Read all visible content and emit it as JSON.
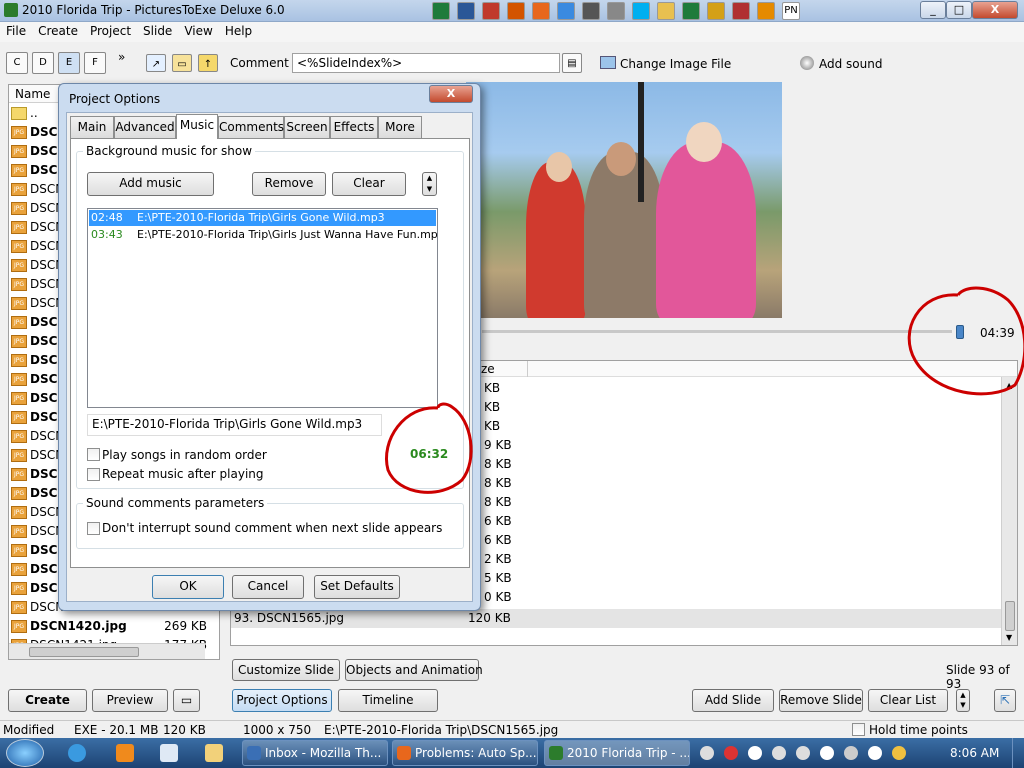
{
  "window": {
    "title": "2010 Florida Trip - PicturesToExe Deluxe 6.0",
    "min": "_",
    "max": "□",
    "close": "X",
    "titlebar_icons": [
      "ms-excel-icon",
      "ms-word-icon",
      "pdf-icon",
      "powerpoint-icon",
      "firefox-icon",
      "chrome-icon",
      "media-icon",
      "mail-icon",
      "skype-icon",
      "folder-icon",
      "excel-icon",
      "pen-icon",
      "home-icon",
      "headset-icon",
      "pn-icon"
    ],
    "pn_label": "PN"
  },
  "menu": [
    "File",
    "Create",
    "Project",
    "Slide",
    "View",
    "Help"
  ],
  "toolbar": {
    "buttons": [
      "C",
      "D",
      "E",
      "F"
    ],
    "more": "»",
    "comment_label": "Comment",
    "comment_value": "<%SlideIndex%>",
    "change_image": "Change Image File",
    "add_sound": "Add sound"
  },
  "filelist": {
    "header": "Name",
    "up": "..",
    "rows": [
      {
        "name": "DSCN",
        "size": "",
        "bold": true
      },
      {
        "name": "DSCN",
        "size": "",
        "bold": true
      },
      {
        "name": "DSCN",
        "size": "",
        "bold": true
      },
      {
        "name": "DSCN",
        "size": "",
        "bold": false
      },
      {
        "name": "DSCN",
        "size": "",
        "bold": false
      },
      {
        "name": "DSCN",
        "size": "",
        "bold": false
      },
      {
        "name": "DSCN",
        "size": "",
        "bold": false
      },
      {
        "name": "DSCN",
        "size": "",
        "bold": false
      },
      {
        "name": "DSCN",
        "size": "",
        "bold": false
      },
      {
        "name": "DSCN",
        "size": "",
        "bold": false
      },
      {
        "name": "DSCN",
        "size": "",
        "bold": true
      },
      {
        "name": "DSCN",
        "size": "",
        "bold": true
      },
      {
        "name": "DSCN",
        "size": "",
        "bold": true
      },
      {
        "name": "DSCN",
        "size": "",
        "bold": true
      },
      {
        "name": "DSCN",
        "size": "",
        "bold": true
      },
      {
        "name": "DSCN",
        "size": "",
        "bold": true
      },
      {
        "name": "DSCN",
        "size": "",
        "bold": false
      },
      {
        "name": "DSCN",
        "size": "",
        "bold": false
      },
      {
        "name": "DSCN",
        "size": "",
        "bold": true
      },
      {
        "name": "DSCN",
        "size": "",
        "bold": true
      },
      {
        "name": "DSCN",
        "size": "",
        "bold": false
      },
      {
        "name": "DSCN",
        "size": "",
        "bold": false
      },
      {
        "name": "DSCN",
        "size": "",
        "bold": true
      },
      {
        "name": "DSCN",
        "size": "",
        "bold": true
      },
      {
        "name": "DSCN",
        "size": "",
        "bold": true
      },
      {
        "name": "DSCN",
        "size": "",
        "bold": false
      },
      {
        "name": "DSCN1420.jpg",
        "size": "269 KB",
        "bold": true
      },
      {
        "name": "DSCN1421.jpg",
        "size": "177 KB",
        "bold": false
      }
    ]
  },
  "preview": {
    "time": "04:39"
  },
  "slidelist": {
    "header_size": "ze",
    "rows": [
      "KB",
      "KB",
      "KB",
      "9 KB",
      "8 KB",
      "8 KB",
      "8 KB",
      "6 KB",
      "6 KB",
      "2 KB",
      "5 KB",
      "0 KB"
    ],
    "selected_name": "93. DSCN1565.jpg",
    "selected_size": "120 KB"
  },
  "dialog": {
    "title": "Project Options",
    "close": "X",
    "tabs": [
      "Main",
      "Advanced",
      "Music",
      "Comments",
      "Screen",
      "Effects",
      "More"
    ],
    "active_tab": "Music",
    "bg_group": "Background music for show",
    "add_music": "Add music",
    "remove": "Remove",
    "clear": "Clear",
    "tracks": [
      {
        "time": "02:48",
        "path": "E:\\PTE-2010-Florida Trip\\Girls Gone Wild.mp3",
        "selected": true
      },
      {
        "time": "03:43",
        "path": "E:\\PTE-2010-Florida Trip\\Girls Just Wanna Have Fun.mp3",
        "selected": false
      }
    ],
    "selected_path": "E:\\PTE-2010-Florida Trip\\Girls Gone Wild.mp3",
    "total_time": "06:32",
    "random_order": "Play songs in random order",
    "repeat": "Repeat music after playing",
    "sound_group": "Sound comments parameters",
    "dont_interrupt": "Don't interrupt sound comment when next slide appears",
    "ok": "OK",
    "cancel": "Cancel",
    "set_defaults": "Set Defaults"
  },
  "bottom": {
    "customize_slide": "Customize Slide",
    "objects_animation": "Objects and Animation",
    "slide_count": "Slide 93 of 93",
    "create": "Create",
    "preview": "Preview",
    "project_options": "Project Options",
    "timeline": "Timeline",
    "add_slide": "Add Slide",
    "remove_slide": "Remove Slide",
    "clear_list": "Clear List"
  },
  "status": {
    "modified": "Modified",
    "exe": "EXE - 20.1 MB",
    "size": "120 KB",
    "dims": "1000 x 750",
    "path": "E:\\PTE-2010-Florida Trip\\DSCN1565.jpg",
    "hold": "Hold time points"
  },
  "taskbar": {
    "tasks": [
      "Inbox - Mozilla Th...",
      "Problems: Auto Sp...",
      "2010 Florida Trip - ..."
    ],
    "clock": "8:06 AM"
  },
  "colors": {
    "accent": "#3399ff",
    "green_time": "#2a8a1e",
    "annotation_red": "#cc0000"
  }
}
